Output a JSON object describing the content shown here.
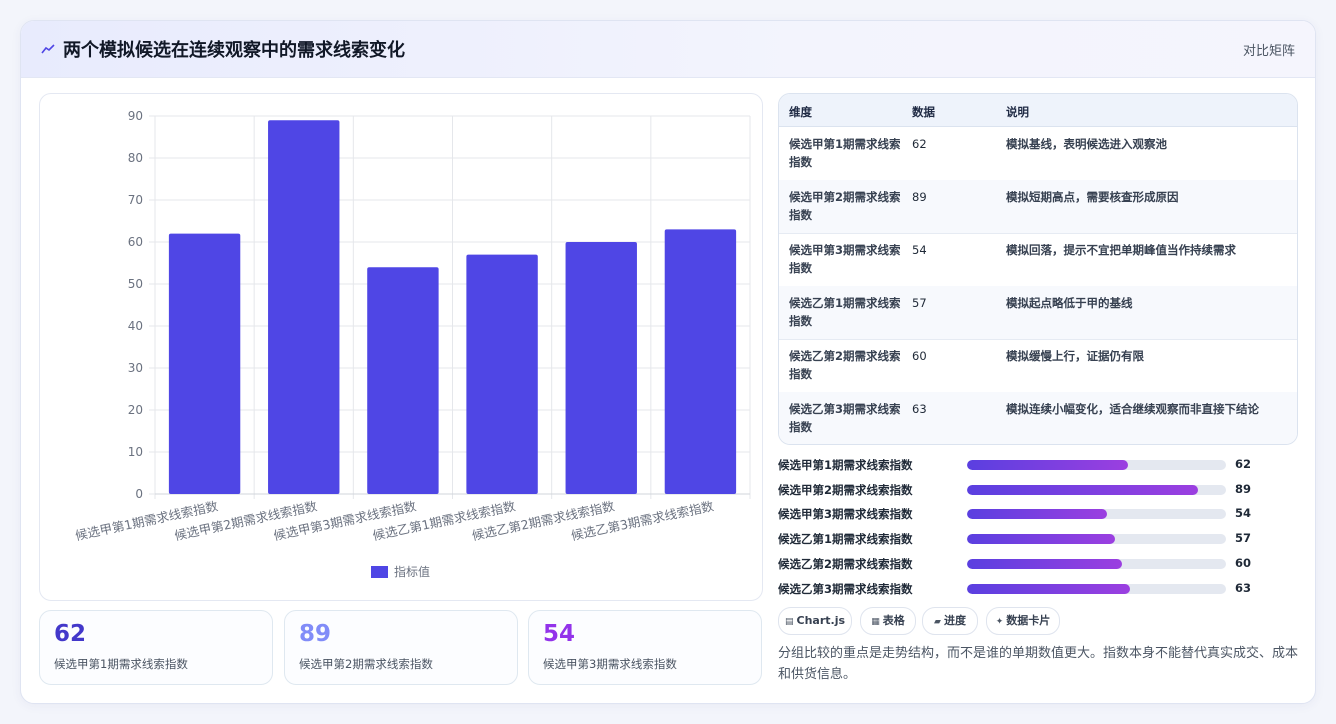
{
  "header": {
    "title": "两个模拟候选在连续观察中的需求线索变化",
    "tag": "对比矩阵"
  },
  "chart_data": {
    "type": "bar",
    "categories": [
      "候选甲第1期需求线索指数",
      "候选甲第2期需求线索指数",
      "候选甲第3期需求线索指数",
      "候选乙第1期需求线索指数",
      "候选乙第2期需求线索指数",
      "候选乙第3期需求线索指数"
    ],
    "series": [
      {
        "name": "指标值",
        "values": [
          62,
          89,
          54,
          57,
          60,
          63
        ]
      }
    ],
    "ylim": [
      0,
      90
    ],
    "yticks": [
      0,
      10,
      20,
      30,
      40,
      50,
      60,
      70,
      80,
      90
    ],
    "grid": true,
    "legend": "bottom",
    "color": "#4f46e5"
  },
  "stats": [
    {
      "value": "62",
      "label": "候选甲第1期需求线索指数",
      "color": "#4338ca"
    },
    {
      "value": "89",
      "label": "候选甲第2期需求线索指数",
      "color": "#818cf8"
    },
    {
      "value": "54",
      "label": "候选甲第3期需求线索指数",
      "color": "#9333ea"
    }
  ],
  "table": {
    "headers": [
      "维度",
      "数据",
      "说明"
    ],
    "rows": [
      {
        "dim": "候选甲第1期需求线索指数",
        "value": "62",
        "desc": "模拟基线，表明候选进入观察池"
      },
      {
        "dim": "候选甲第2期需求线索指数",
        "value": "89",
        "desc": "模拟短期高点，需要核查形成原因"
      },
      {
        "dim": "候选甲第3期需求线索指数",
        "value": "54",
        "desc": "模拟回落，提示不宜把单期峰值当作持续需求"
      },
      {
        "dim": "候选乙第1期需求线索指数",
        "value": "57",
        "desc": "模拟起点略低于甲的基线"
      },
      {
        "dim": "候选乙第2期需求线索指数",
        "value": "60",
        "desc": "模拟缓慢上行，证据仍有限"
      },
      {
        "dim": "候选乙第3期需求线索指数",
        "value": "63",
        "desc": "模拟连续小幅变化，适合继续观察而非直接下结论"
      }
    ]
  },
  "progress": {
    "max": 100,
    "items": [
      {
        "label": "候选甲第1期需求线索指数",
        "value": 62
      },
      {
        "label": "候选甲第2期需求线索指数",
        "value": 89
      },
      {
        "label": "候选甲第3期需求线索指数",
        "value": 54
      },
      {
        "label": "候选乙第1期需求线索指数",
        "value": 57
      },
      {
        "label": "候选乙第2期需求线索指数",
        "value": 60
      },
      {
        "label": "候选乙第3期需求线索指数",
        "value": 63
      }
    ]
  },
  "chips": [
    {
      "icon": "▤",
      "label": "Chart.js"
    },
    {
      "icon": "▦",
      "label": "表格"
    },
    {
      "icon": "▰",
      "label": "进度"
    },
    {
      "icon": "✦",
      "label": "数据卡片"
    }
  ],
  "note": "分组比较的重点是走势结构，而不是谁的单期数值更大。指数本身不能替代真实成交、成本和供货信息。"
}
